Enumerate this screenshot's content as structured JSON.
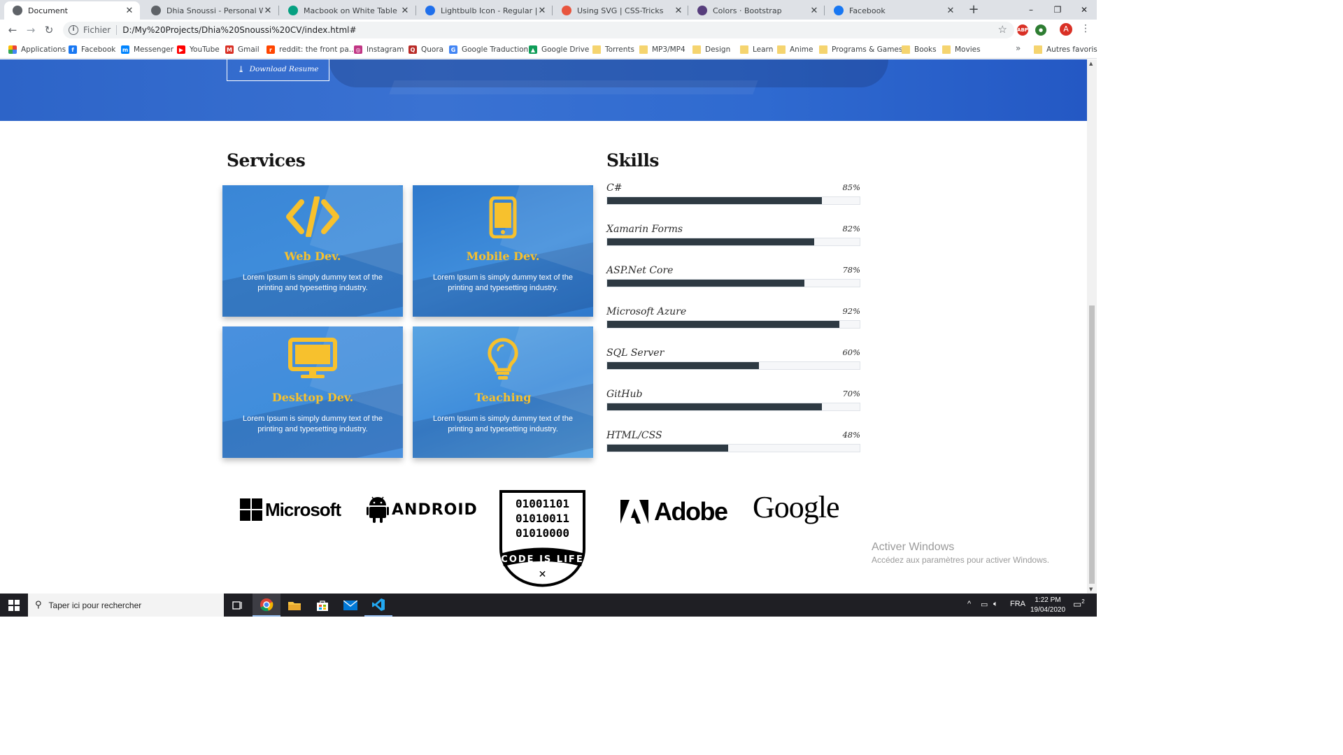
{
  "browser": {
    "tabs": [
      {
        "title": "Document",
        "active": true,
        "fav_color": "#5f6368"
      },
      {
        "title": "Dhia Snoussi - Personal Website",
        "active": false,
        "fav_color": "#5f6368"
      },
      {
        "title": "Macbook on White Table · Free S",
        "active": false,
        "fav_color": "#05a081"
      },
      {
        "title": "Lightbulb Icon - Regular | Font A",
        "active": false,
        "fav_color": "#1f6feb"
      },
      {
        "title": "Using SVG | CSS-Tricks",
        "active": false,
        "fav_color": "#e8553e"
      },
      {
        "title": "Colors · Bootstrap",
        "active": false,
        "fav_color": "#563d7c"
      },
      {
        "title": "Facebook",
        "active": false,
        "fav_color": "#1877f2"
      }
    ],
    "new_tab": "+",
    "window_controls": {
      "minimize": "–",
      "maximize": "❐",
      "close": "✕"
    },
    "address": {
      "scheme": "Fichier",
      "url": "D:/My%20Projects/Dhia%20Snoussi%20CV/index.html#"
    },
    "bookmarks": [
      {
        "label": "Applications",
        "kind": "apps"
      },
      {
        "label": "Facebook",
        "kind": "site",
        "color": "#1877f2",
        "glyph": "f"
      },
      {
        "label": "Messenger",
        "kind": "site",
        "color": "#0084ff",
        "glyph": "m"
      },
      {
        "label": "YouTube",
        "kind": "site",
        "color": "#ff0000",
        "glyph": "▶"
      },
      {
        "label": "Gmail",
        "kind": "site",
        "color": "#d93025",
        "glyph": "M"
      },
      {
        "label": "reddit: the front pa...",
        "kind": "site",
        "color": "#ff4500",
        "glyph": "r"
      },
      {
        "label": "Instagram",
        "kind": "site",
        "color": "#c13584",
        "glyph": "◎"
      },
      {
        "label": "Quora",
        "kind": "site",
        "color": "#b92b27",
        "glyph": "Q"
      },
      {
        "label": "Google Traduction",
        "kind": "site",
        "color": "#4285f4",
        "glyph": "G"
      },
      {
        "label": "Google Drive",
        "kind": "site",
        "color": "#0f9d58",
        "glyph": "▲"
      },
      {
        "label": "Torrents",
        "kind": "folder"
      },
      {
        "label": "MP3/MP4",
        "kind": "folder"
      },
      {
        "label": "Design",
        "kind": "folder"
      },
      {
        "label": "Learn",
        "kind": "folder"
      },
      {
        "label": "Anime",
        "kind": "folder"
      },
      {
        "label": "Programs & Games",
        "kind": "folder"
      },
      {
        "label": "Books",
        "kind": "folder"
      },
      {
        "label": "Movies",
        "kind": "folder"
      }
    ],
    "more_bookmarks": "»",
    "other_bookmarks": "Autres favoris",
    "profile_initial": "A"
  },
  "page": {
    "download_button": "Download Resume",
    "services_title": "Services",
    "skills_title": "Skills",
    "services": [
      {
        "title": "Web Dev.",
        "desc": "Lorem Ipsum is simply dummy text of the printing and typesetting industry.",
        "icon": "code-icon",
        "bg": "#3a86d6"
      },
      {
        "title": "Mobile Dev.",
        "desc": "Lorem Ipsum is simply dummy text of the printing and typesetting industry.",
        "icon": "mobile-icon",
        "bg": "#2f79cc"
      },
      {
        "title": "Desktop Dev.",
        "desc": "Lorem Ipsum is simply dummy text of the printing and typesetting industry.",
        "icon": "desktop-icon",
        "bg": "#4a90de"
      },
      {
        "title": "Teaching",
        "desc": "Lorem Ipsum is simply dummy text of the printing and typesetting industry.",
        "icon": "lightbulb-icon",
        "bg": "#5aa4e2"
      }
    ],
    "skills": [
      {
        "name": "C#",
        "pct_label": "85%",
        "value": 85
      },
      {
        "name": "Xamarin Forms",
        "pct_label": "82%",
        "value": 82
      },
      {
        "name": "ASP.Net Core",
        "pct_label": "78%",
        "value": 78
      },
      {
        "name": "Microsoft Azure",
        "pct_label": "92%",
        "value": 92
      },
      {
        "name": "SQL Server",
        "pct_label": "60%",
        "value": 60
      },
      {
        "name": "GitHub",
        "pct_label": "70%",
        "value": 85
      },
      {
        "name": "HTML/CSS",
        "pct_label": "48%",
        "value": 48
      }
    ],
    "logos": {
      "microsoft": "Microsoft",
      "android": "ANDROID",
      "code_badge_lines": [
        "01001101",
        "01010011",
        "01010000"
      ],
      "code_badge_motto": "CODE IS LIFE",
      "adobe": "Adobe",
      "google": "Google"
    },
    "watermark": {
      "line1": "Activer Windows",
      "line2": "Accédez aux paramètres pour activer Windows."
    }
  },
  "taskbar": {
    "search_placeholder": "Taper ici pour rechercher",
    "language": "FRA",
    "time": "1:22 PM",
    "date": "19/04/2020",
    "notifications": "2"
  }
}
